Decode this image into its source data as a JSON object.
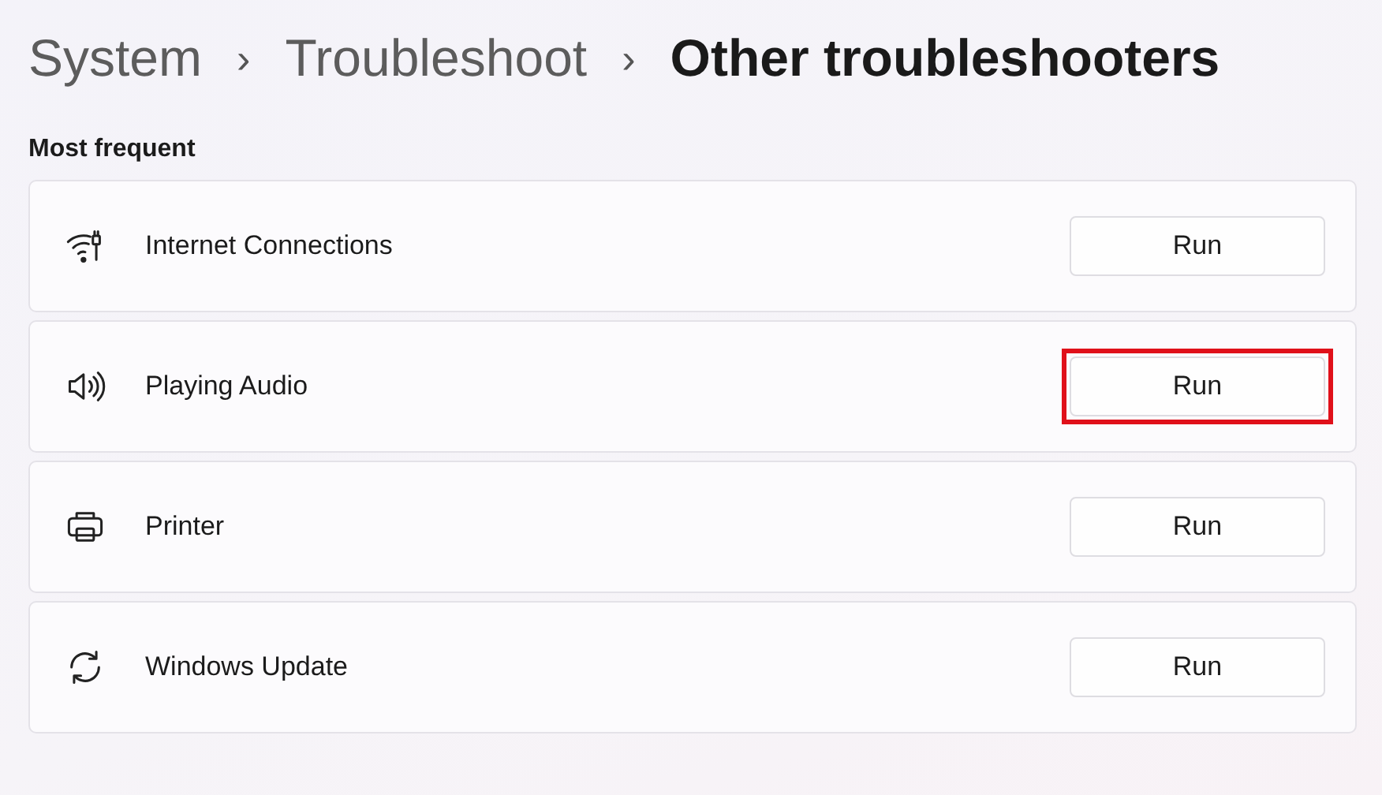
{
  "breadcrumb": [
    {
      "label": "System",
      "current": false
    },
    {
      "label": "Troubleshoot",
      "current": false
    },
    {
      "label": "Other troubleshooters",
      "current": true
    }
  ],
  "separator": "›",
  "section": {
    "title": "Most frequent"
  },
  "troubleshooters": [
    {
      "kind": "wifi",
      "name": "Internet Connections",
      "button": "Run",
      "highlighted": false
    },
    {
      "kind": "speaker",
      "name": "Playing Audio",
      "button": "Run",
      "highlighted": true
    },
    {
      "kind": "printer",
      "name": "Printer",
      "button": "Run",
      "highlighted": false
    },
    {
      "kind": "update",
      "name": "Windows Update",
      "button": "Run",
      "highlighted": false
    }
  ]
}
